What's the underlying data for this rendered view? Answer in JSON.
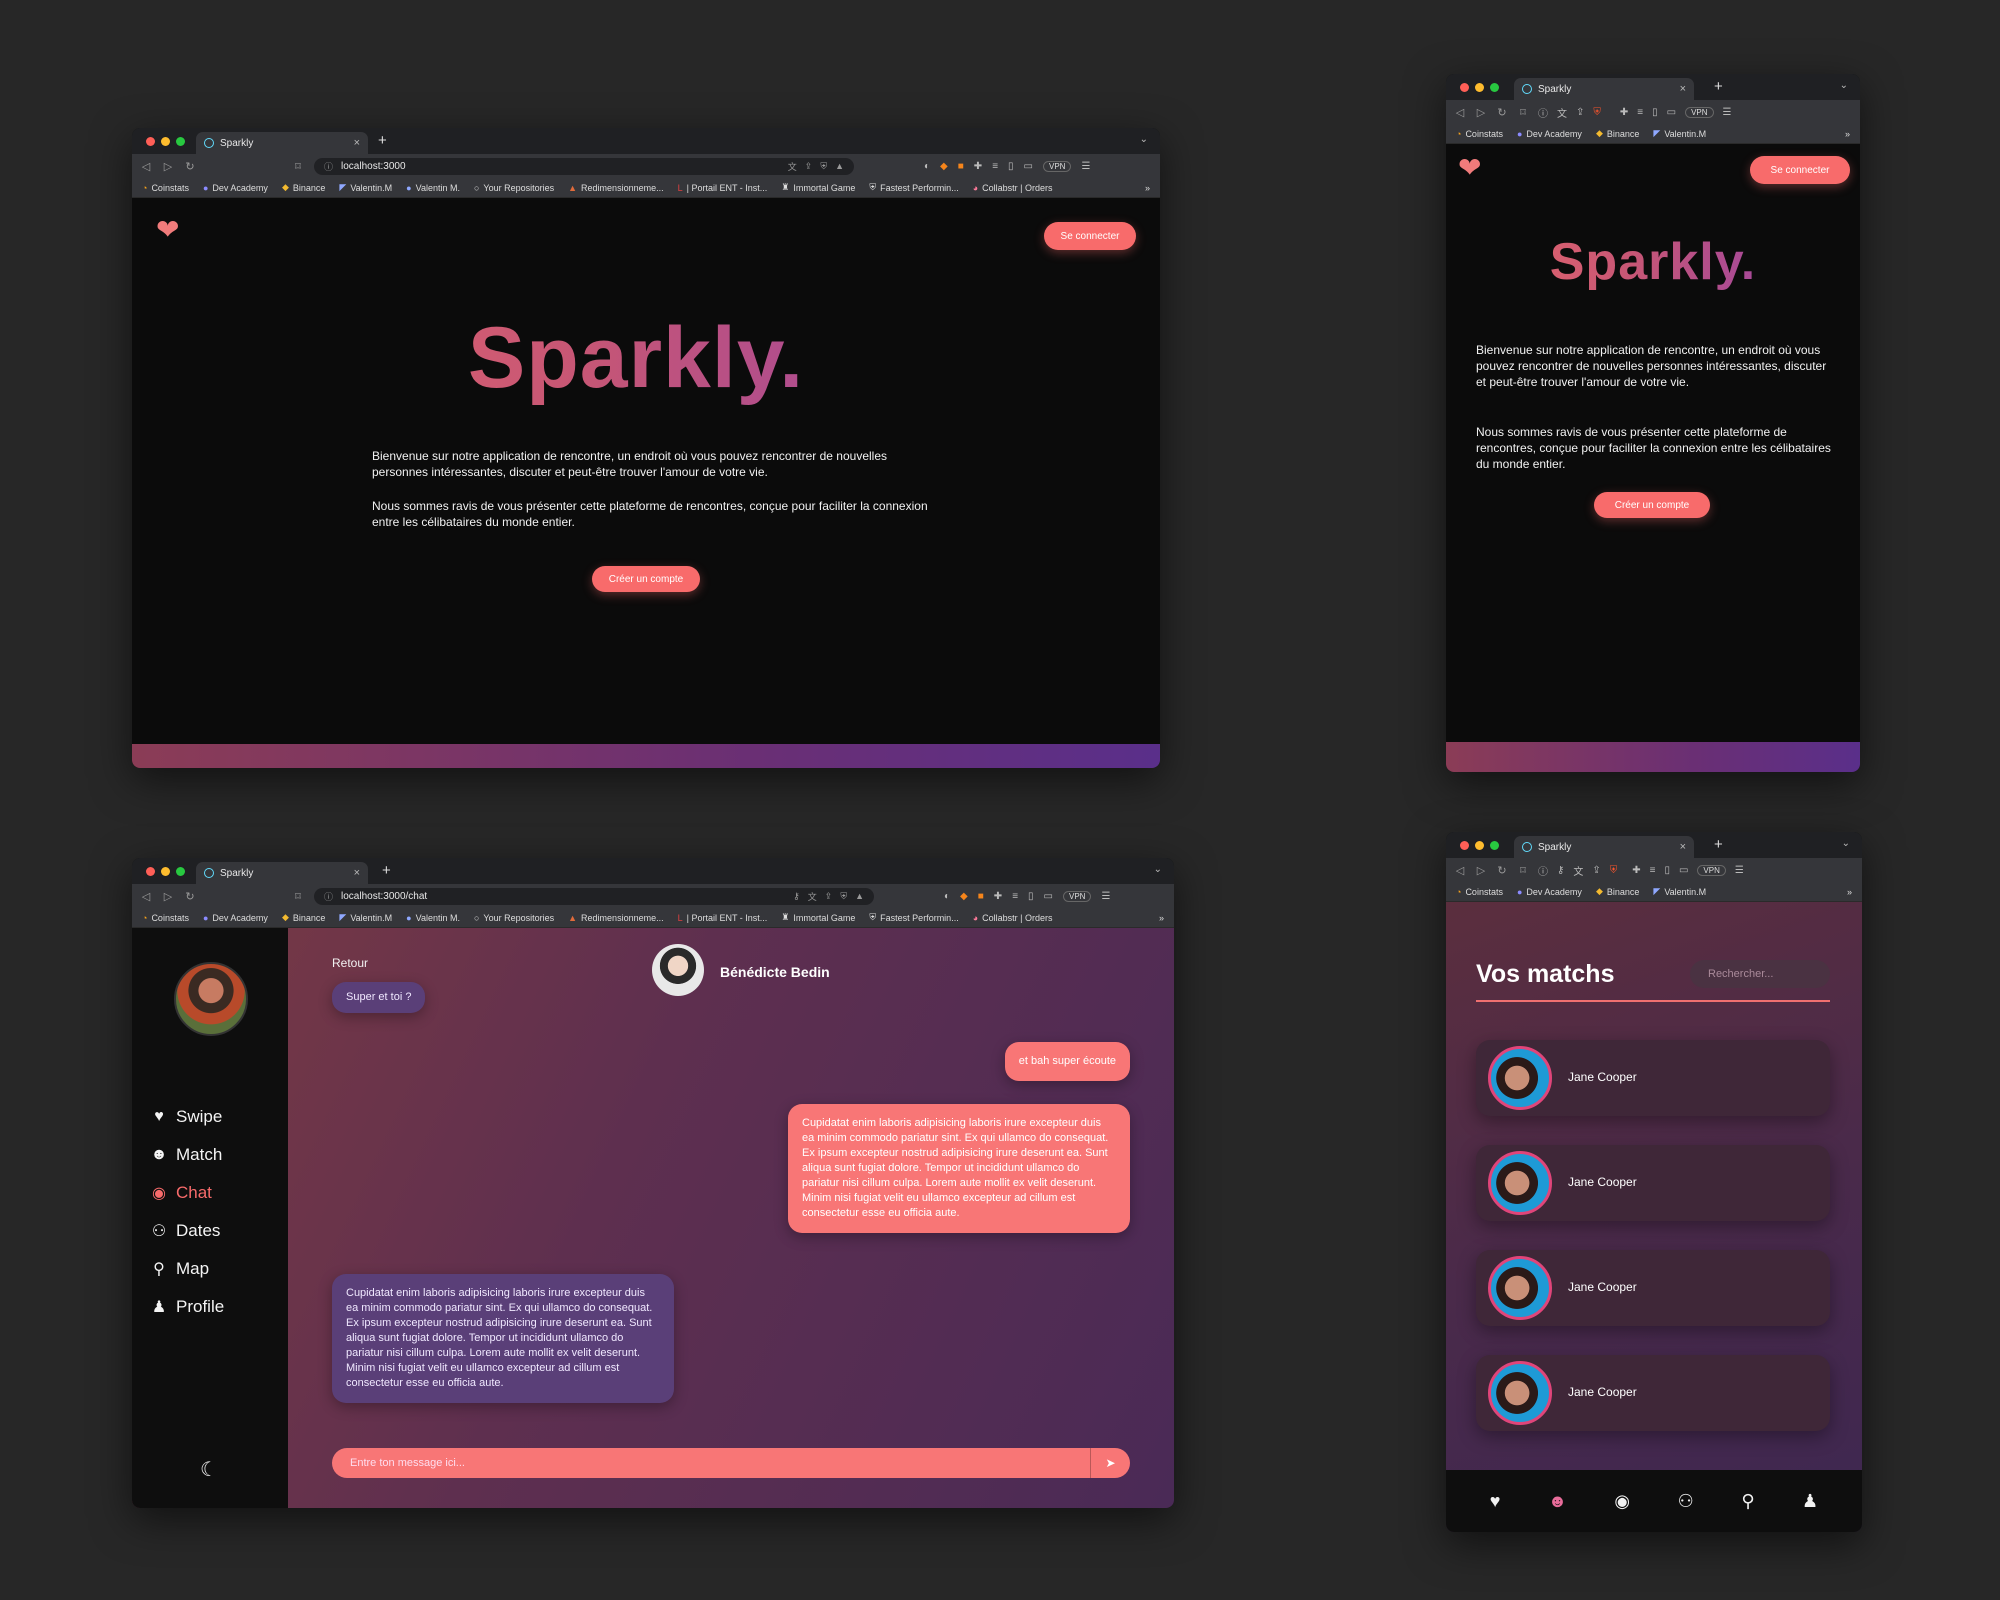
{
  "browser": {
    "tab_title": "Sparkly",
    "new_tab": "+",
    "close": "×",
    "vpn": "VPN"
  },
  "bookmarks_long": [
    "Coinstats",
    "Dev Academy",
    "Binance",
    "Valentin.M",
    "Valentin M.",
    "Your Repositories",
    "Redimensionneme...",
    "| Portail ENT - Inst...",
    "Immortal Game",
    "Fastest Performin...",
    "Collabstr | Orders"
  ],
  "bookmarks_short": [
    "Coinstats",
    "Dev Academy",
    "Binance",
    "Valentin.M"
  ],
  "bookmarks_more": "»",
  "landing": {
    "url": "localhost:3000",
    "login_button": "Se connecter",
    "brand": "Sparkly.",
    "paragraph_1": "Bienvenue sur notre application de rencontre, un endroit où vous pouvez rencontrer de nouvelles personnes intéressantes, discuter et peut-être trouver l'amour de votre vie.",
    "paragraph_2": "Nous sommes ravis de vous présenter cette plateforme de rencontres, conçue pour faciliter la connexion entre les célibataires du monde entier.",
    "signup_button": "Créer un compte"
  },
  "chat": {
    "url": "localhost:3000/chat",
    "nav": [
      "Swipe",
      "Match",
      "Chat",
      "Dates",
      "Map",
      "Profile"
    ],
    "back": "Retour",
    "partner_name": "Bénédicte Bedin",
    "msg_them_1": "Super et toi ?",
    "msg_me_1": "et bah super écoute",
    "msg_me_2": "Cupidatat enim laboris adipisicing laboris irure excepteur duis ea minim commodo pariatur sint. Ex qui ullamco do consequat. Ex ipsum excepteur nostrud adipisicing irure deserunt ea. Sunt aliqua sunt fugiat dolore. Tempor ut incididunt ullamco do pariatur nisi cillum culpa. Lorem aute mollit ex velit deserunt. Minim nisi fugiat velit eu ullamco excepteur ad cillum est consectetur esse eu officia aute.",
    "msg_them_2": "Cupidatat enim laboris adipisicing laboris irure excepteur duis ea minim commodo pariatur sint. Ex qui ullamco do consequat. Ex ipsum excepteur nostrud adipisicing irure deserunt ea. Sunt aliqua sunt fugiat dolore. Tempor ut incididunt ullamco do pariatur nisi cillum culpa. Lorem aute mollit ex velit deserunt. Minim nisi fugiat velit eu ullamco excepteur ad cillum est consectetur esse eu officia aute.",
    "input_placeholder": "Entre ton message ici..."
  },
  "matches": {
    "title": "Vos matchs",
    "search_placeholder": "Rechercher...",
    "items": [
      "Jane Cooper",
      "Jane Cooper",
      "Jane Cooper",
      "Jane Cooper"
    ]
  },
  "colors": {
    "accent": "#f86b6b",
    "purple": "#5a3f78",
    "background": "#272727"
  }
}
